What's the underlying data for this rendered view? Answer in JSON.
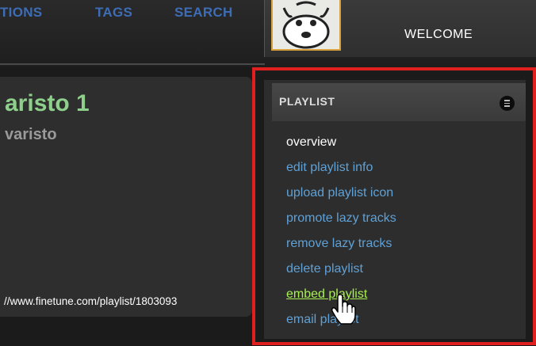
{
  "nav": {
    "items": [
      "TIONS",
      "TAGS",
      "SEARCH"
    ]
  },
  "header": {
    "welcome": "WELCOME"
  },
  "playlist": {
    "title": "aristo 1",
    "owner": "varisto",
    "url": "//www.finetune.com/playlist/1803093"
  },
  "sidebar": {
    "heading": "PLAYLIST",
    "items": [
      {
        "label": "overview"
      },
      {
        "label": "edit playlist info"
      },
      {
        "label": "upload playlist icon"
      },
      {
        "label": "promote lazy tracks"
      },
      {
        "label": "remove lazy tracks"
      },
      {
        "label": "delete playlist"
      },
      {
        "label": "embed playlist"
      },
      {
        "label": "email playlist"
      }
    ]
  },
  "colors": {
    "nav_link": "#3d6db6",
    "title_green": "#8ed08b",
    "sidebar_link": "#5fa1d6",
    "hovered_link": "#a7f04f",
    "highlight_frame": "#e01f1f"
  },
  "icons": [
    "mascot-avatar-icon",
    "list-menu-icon",
    "hand-pointer-icon"
  ]
}
